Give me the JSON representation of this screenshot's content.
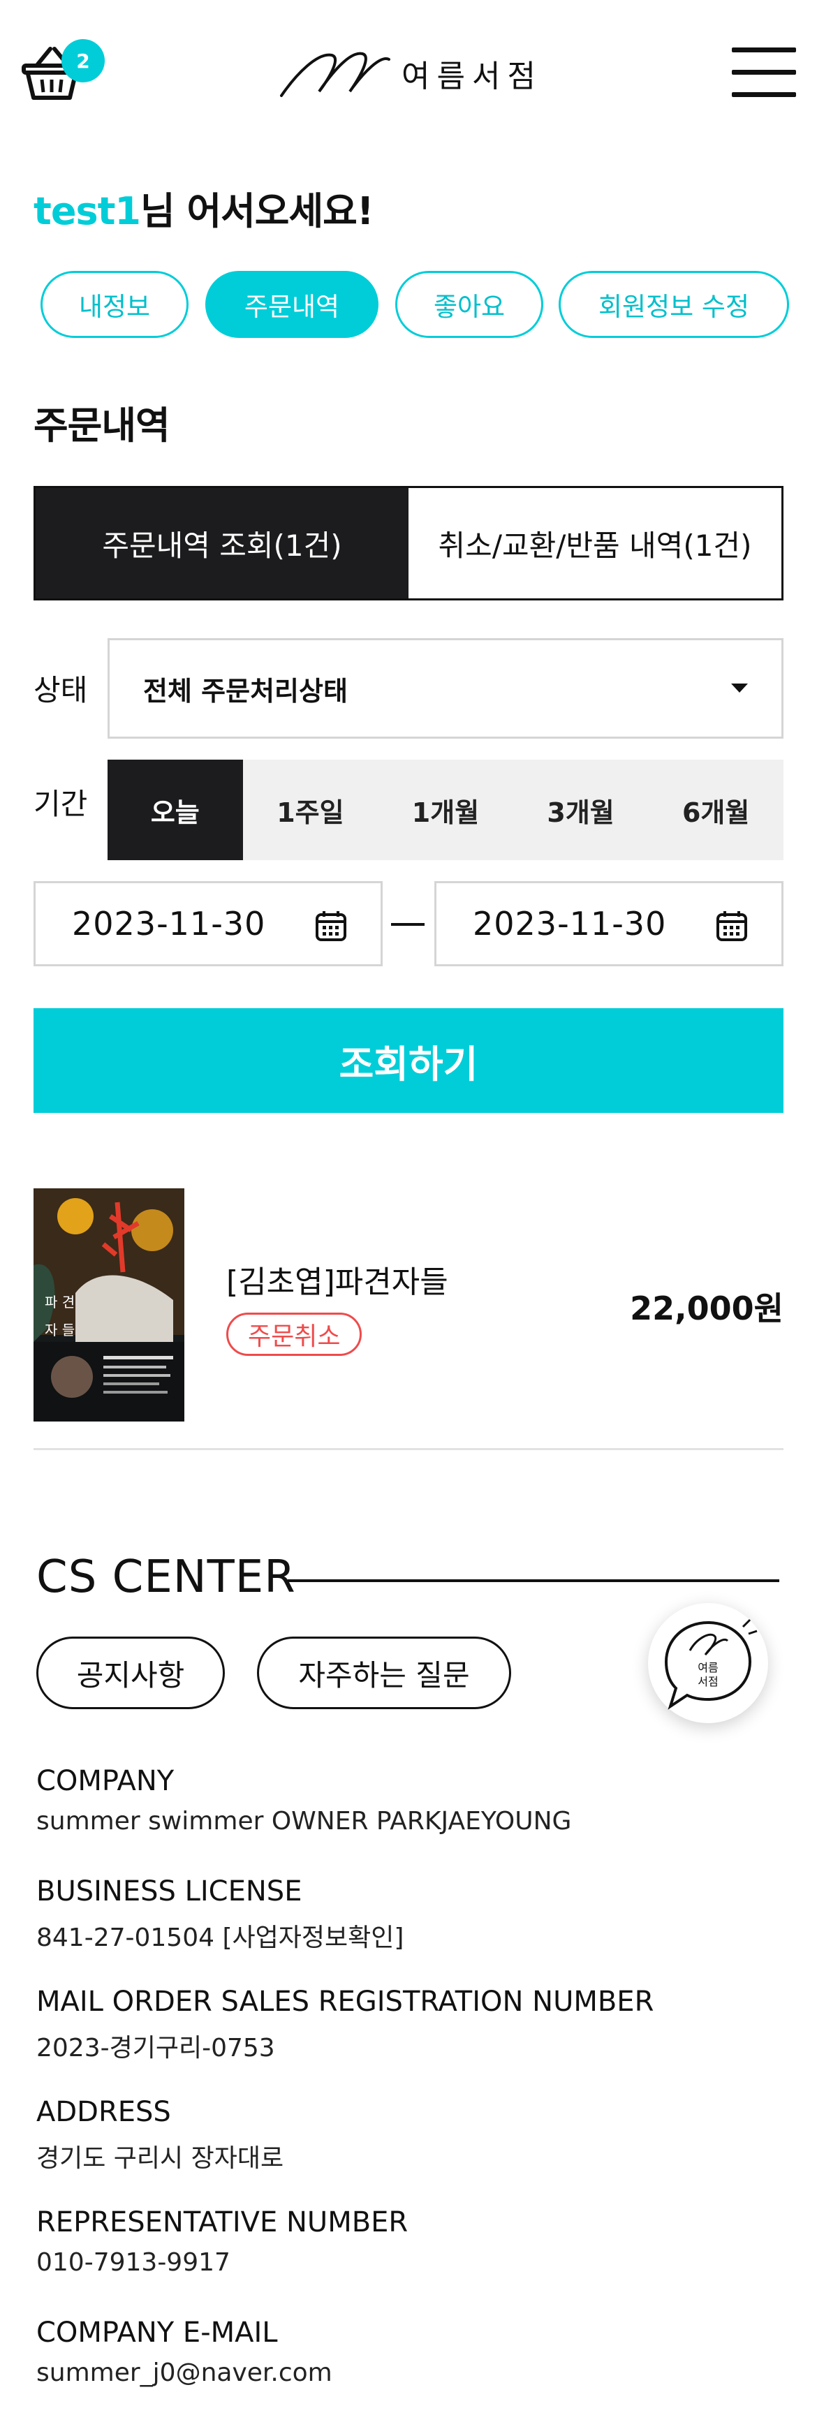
{
  "header": {
    "cart_count": "2",
    "logo_text": "여름서점",
    "cart_icon": "basket-icon",
    "menu_icon": "hamburger-menu-icon"
  },
  "greeting": {
    "user": "test1",
    "suffix": "님 어서오세요!"
  },
  "tabs": [
    "내정보",
    "주문내역",
    "좋아요",
    "회원정보 수정"
  ],
  "active_tab": "주문내역",
  "section_title": "주문내역",
  "order_switch": [
    "주문내역 조회(1건)",
    "취소/교환/반품 내역(1건)"
  ],
  "filters": {
    "status_label": "상태",
    "status_value": "전체 주문처리상태",
    "period_label": "기간",
    "periods": [
      "오늘",
      "1주일",
      "1개월",
      "3개월",
      "6개월"
    ],
    "selected_period": "오늘",
    "date_from": "2023-11-30",
    "date_to": "2023-11-30",
    "search_button": "조회하기"
  },
  "order": {
    "title": "[김초엽]파견자들",
    "status": "주문취소",
    "price": "22,000원",
    "cover_lines": [
      "파 견",
      "자 들"
    ]
  },
  "cs": {
    "title": "CS CENTER",
    "buttons": [
      "공지사항",
      "자주하는 질문"
    ],
    "chat_text": "여름\n서점",
    "info": [
      {
        "k": "COMPANY",
        "v": "summer swimmer OWNER PARKJAEYOUNG"
      },
      {
        "k": "BUSINESS LICENSE",
        "v": "841-27-01504 [사업자정보확인]"
      },
      {
        "k": "MAIL ORDER SALES REGISTRATION NUMBER",
        "v": "2023-경기구리-0753"
      },
      {
        "k": "ADDRESS",
        "v": "경기도 구리시 장자대로"
      },
      {
        "k": "REPRESENTATIVE NUMBER",
        "v": "010-7913-9917"
      },
      {
        "k": "COMPANY E-MAIL",
        "v": "summer_j0@naver.com"
      }
    ]
  },
  "colors": {
    "accent": "#00cdd8",
    "dark": "#1c1c1e",
    "cancel": "#ef4b4b"
  }
}
